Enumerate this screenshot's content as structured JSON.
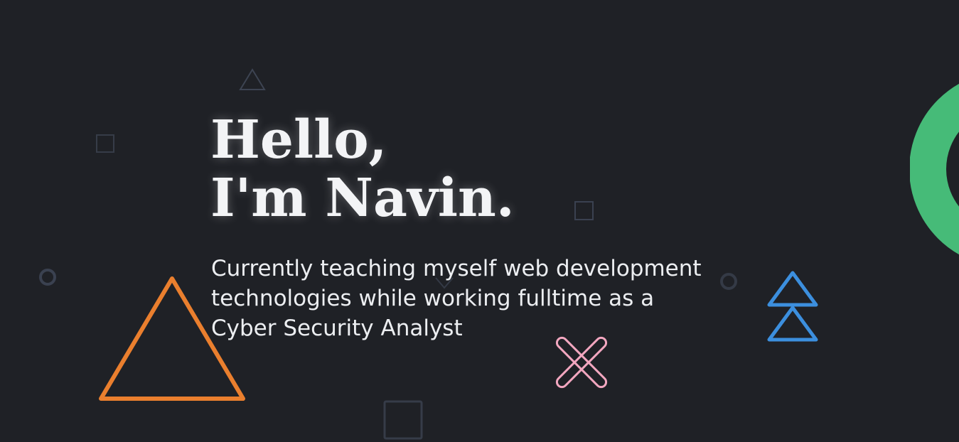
{
  "hero": {
    "greeting_line1": "Hello,",
    "greeting_line2": "I'm Navin.",
    "subtitle_line1": "Currently teaching myself web development",
    "subtitle_line2": "technologies while working fulltime as a",
    "subtitle_line3": "Cyber Security Analyst"
  },
  "colors": {
    "background": "#1f2126",
    "text": "#f3f4f6",
    "muted_shape": "#3a4150",
    "orange": "#ea7f2e",
    "blue": "#3c8fde",
    "pink": "#f3a7c0",
    "green": "#46bb78"
  },
  "icons": [
    "triangle-outline-icon",
    "square-outline-icon",
    "circle-outline-icon",
    "chevron-down-icon",
    "double-triangle-icon",
    "cross-icon",
    "ring-icon"
  ]
}
